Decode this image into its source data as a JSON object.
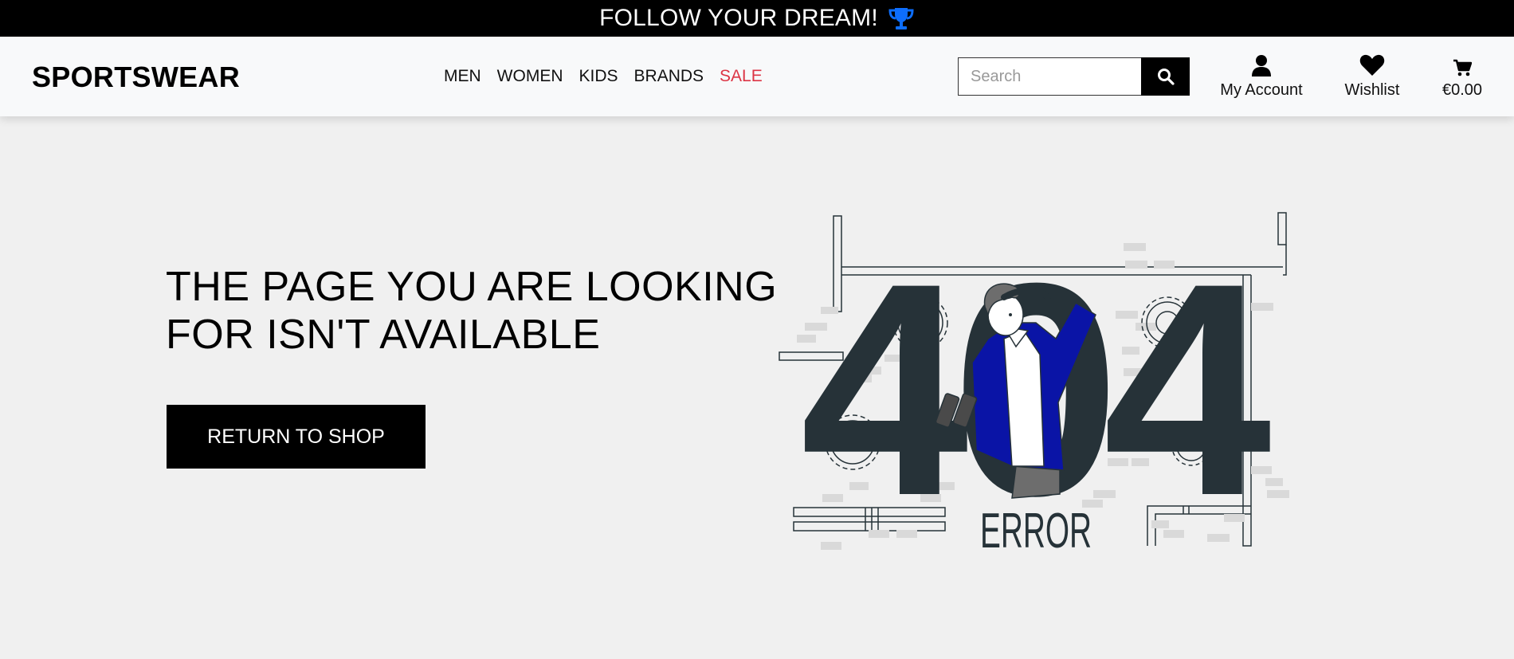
{
  "promo": {
    "text": "FOLLOW YOUR DREAM!",
    "icon": "trophy-icon",
    "icon_color": "#0d6efd"
  },
  "header": {
    "logo": "SPORTSWEAR",
    "nav": [
      {
        "label": "MEN"
      },
      {
        "label": "WOMEN"
      },
      {
        "label": "KIDS"
      },
      {
        "label": "BRANDS"
      },
      {
        "label": "SALE",
        "color": "#dc3545"
      }
    ],
    "search": {
      "placeholder": "Search",
      "value": "",
      "icon": "search-icon"
    },
    "account": {
      "label": "My Account",
      "icon": "user-icon"
    },
    "wishlist": {
      "label": "Wishlist",
      "icon": "heart-icon"
    },
    "cart": {
      "total": "€0.00",
      "icon": "cart-icon"
    }
  },
  "main": {
    "title_line1": "THE PAGE YOU ARE LOOKING",
    "title_line2": "FOR ISN'T AVAILABLE",
    "cta_label": "RETURN TO SHOP",
    "illustration": {
      "digit_left": "4",
      "digit_middle": "0",
      "digit_right": "4",
      "caption": "ERROR",
      "digit_color": "#263238",
      "accent_color": "#0a14a6"
    }
  }
}
